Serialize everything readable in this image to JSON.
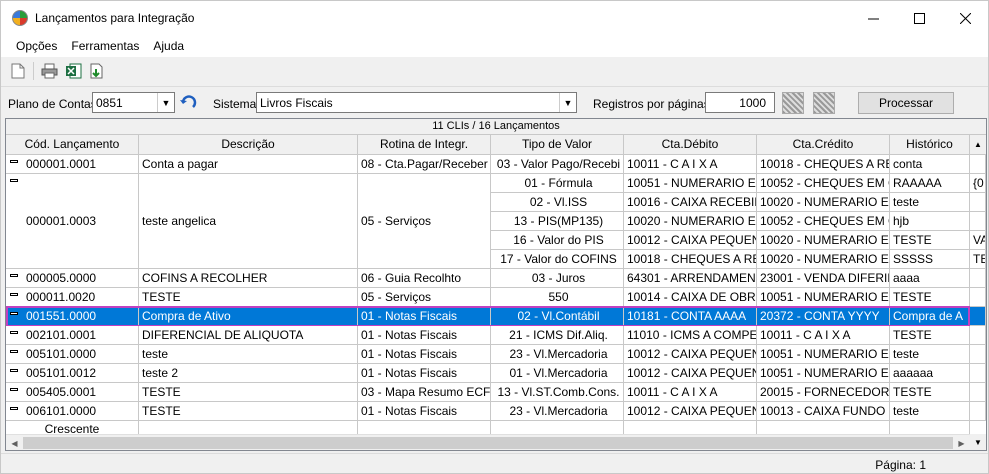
{
  "window": {
    "title": "Lançamentos para Integração"
  },
  "menu": {
    "items": [
      "Opções",
      "Ferramentas",
      "Ajuda"
    ]
  },
  "toolbar": {
    "icons": [
      "new-document-icon",
      "print-icon",
      "excel-export-icon",
      "import-icon"
    ]
  },
  "filters": {
    "plano_label": "Plano de Contas",
    "plano_value": "0851",
    "sistema_label": "Sistema",
    "sistema_value": "Livros Fiscais",
    "registros_label": "Registros por páginas:",
    "registros_value": "1000",
    "processar_label": "Processar"
  },
  "grid": {
    "caption": "11 CLIs / 16 Lançamentos",
    "headers": [
      "Cód. Lançamento",
      "Descrição",
      "Rotina de Integr.",
      "Tipo de Valor",
      "Cta.Débito",
      "Cta.Crédito",
      "Histórico"
    ],
    "rows": [
      {
        "cod": "000001.0001",
        "desc": "Conta a pagar",
        "rotina": "08 - Cta.Pagar/Receber",
        "lines": [
          [
            "03 - Valor Pago/Recebi",
            "10011 - C A I X A",
            "10018 - CHEQUES A RECEB",
            "conta",
            ""
          ]
        ]
      },
      {
        "cod": "000001.0003",
        "desc": "teste angelica",
        "rotina": "05 - Serviços",
        "lines": [
          [
            "01 - Fórmula",
            "10051 - NUMERARIO EM TR",
            "10052 - CHEQUES EM COB",
            "RAAAAA",
            "{0"
          ],
          [
            "02 - Vl.ISS",
            "10016 - CAIXA RECEBIMEN",
            "10020 - NUMERARIO EM TI",
            "teste",
            ""
          ],
          [
            "13 - PIS(MP135)",
            "10020 - NUMERARIO EM TI",
            "10052 - CHEQUES EM COB",
            "hjb",
            ""
          ],
          [
            "16 - Valor do PIS",
            "10012 - CAIXA PEQUENA",
            "10020 - NUMERARIO EM TI",
            "TESTE",
            "VA"
          ],
          [
            "17 - Valor do COFINS",
            "10018 - CHEQUES A RECEB",
            "10020 - NUMERARIO EM TI",
            "SSSSS",
            "TE"
          ]
        ]
      },
      {
        "cod": "000005.0000",
        "desc": "COFINS A RECOLHER",
        "rotina": "06 - Guia Recolhto",
        "lines": [
          [
            "03 - Juros",
            "64301 - ARRENDAMENTO A",
            "23001 - VENDA DIFERIDA I",
            "aaaa",
            ""
          ]
        ]
      },
      {
        "cod": "000011.0020",
        "desc": "TESTE",
        "rotina": "05 - Serviços",
        "lines": [
          [
            "550",
            "10014 - CAIXA DE OBRAS",
            "10051 - NUMERARIO EM TI",
            "TESTE",
            ""
          ]
        ]
      },
      {
        "cod": "001551.0000",
        "desc": "Compra de Ativo",
        "rotina": "01 - Notas Fiscais",
        "selected": true,
        "lines": [
          [
            "02 - Vl.Contábil",
            "10181 - CONTA AAAA",
            "20372 - CONTA YYYY",
            "Compra de A",
            ""
          ]
        ]
      },
      {
        "cod": "002101.0001",
        "desc": "DIFERENCIAL DE ALIQUOTA",
        "rotina": "01 - Notas Fiscais",
        "lines": [
          [
            "21 - ICMS Dif.Aliq.",
            "11010 - ICMS A COMPENSA",
            "10011 - C A I X A",
            "TESTE",
            ""
          ]
        ]
      },
      {
        "cod": "005101.0000",
        "desc": "teste",
        "rotina": "01 - Notas Fiscais",
        "lines": [
          [
            "23 - Vl.Mercadoria",
            "10012 - CAIXA PEQUENA",
            "10051 - NUMERARIO EM TI",
            "teste",
            ""
          ]
        ]
      },
      {
        "cod": "005101.0012",
        "desc": "teste 2",
        "rotina": "01 - Notas Fiscais",
        "lines": [
          [
            "01 - Vl.Mercadoria",
            "10012 - CAIXA PEQUENA",
            "10051 - NUMERARIO EM TI",
            "aaaaaa",
            ""
          ]
        ]
      },
      {
        "cod": "005405.0001",
        "desc": "TESTE",
        "rotina": "03 - Mapa Resumo ECF",
        "lines": [
          [
            "13 - Vl.ST.Comb.Cons.",
            "10011 - C A I X A",
            "20015 - FORNECEDORES",
            "TESTE",
            ""
          ]
        ]
      },
      {
        "cod": "006101.0000",
        "desc": "TESTE",
        "rotina": "01 - Notas Fiscais",
        "lines": [
          [
            "23 - Vl.Mercadoria",
            "10012 - CAIXA PEQUENA",
            "10013 - CAIXA FUNDO FIX",
            "teste",
            ""
          ]
        ]
      }
    ],
    "sort_label": "Crescente"
  },
  "status": {
    "page": "Página: 1"
  }
}
